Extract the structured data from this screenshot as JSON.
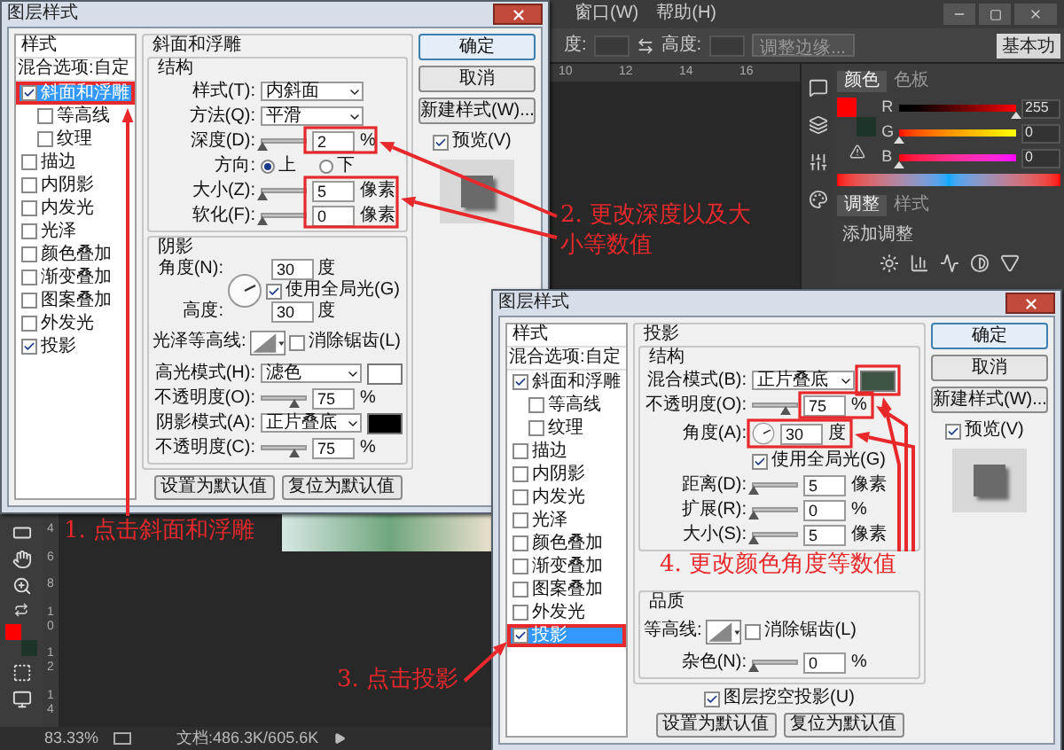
{
  "menu": [
    {
      "label": "窗口(W)"
    },
    {
      "label": "帮助(H)"
    }
  ],
  "options_bar": {
    "fields": [
      {
        "label": "度:"
      },
      {
        "label": "高度:"
      }
    ],
    "refine_button": "调整边缘...",
    "workspace_button": "基本功"
  },
  "top_ruler": [
    "10",
    "12",
    "14",
    "16"
  ],
  "left_ruler": [
    "4",
    "6",
    "8",
    "10",
    "12",
    "14"
  ],
  "color_panel": {
    "tabs": [
      {
        "label": "颜色",
        "selected": true
      },
      {
        "label": "色板",
        "selected": false
      }
    ],
    "foreground": {
      "color": "#ff0000"
    },
    "background": {
      "color": "#1d3528"
    },
    "channels": [
      {
        "name": "R",
        "level": 1,
        "value": "255"
      },
      {
        "name": "G",
        "level": 0,
        "value": "0"
      },
      {
        "name": "B",
        "level": 0,
        "value": "0"
      }
    ]
  },
  "adjustments_panel": {
    "tabs": [
      {
        "label": "调整",
        "selected": true
      },
      {
        "label": "样式",
        "selected": false
      }
    ],
    "title": "添加调整"
  },
  "status_bar": {
    "zoom": "83.33%",
    "document": "文档:486.3K/605.6K"
  },
  "dialogs": [
    {
      "title": "图层样式",
      "styles": {
        "header": "样式",
        "blend": "混合选项:自定",
        "items": [
          {
            "label": "斜面和浮雕",
            "checked": true,
            "selected": true,
            "highlighted": true,
            "children": [
              {
                "label": "等高线",
                "checked": false,
                "selected": false,
                "highlighted": false
              },
              {
                "label": "纹理",
                "checked": false,
                "selected": false,
                "highlighted": false
              }
            ]
          },
          {
            "label": "描边",
            "checked": false,
            "selected": false,
            "highlighted": false
          },
          {
            "label": "内阴影",
            "checked": false,
            "selected": false,
            "highlighted": false
          },
          {
            "label": "内发光",
            "checked": false,
            "selected": false,
            "highlighted": false
          },
          {
            "label": "光泽",
            "checked": false,
            "selected": false,
            "highlighted": false
          },
          {
            "label": "颜色叠加",
            "checked": false,
            "selected": false,
            "highlighted": false
          },
          {
            "label": "渐变叠加",
            "checked": false,
            "selected": false,
            "highlighted": false
          },
          {
            "label": "图案叠加",
            "checked": false,
            "selected": false,
            "highlighted": false
          },
          {
            "label": "外发光",
            "checked": false,
            "selected": false,
            "highlighted": false
          },
          {
            "label": "投影",
            "checked": true,
            "selected": false,
            "highlighted": false
          }
        ]
      },
      "section": {
        "title": "斜面和浮雕",
        "groups": [
          {
            "title": "结构",
            "rows": [
              {
                "kind": "select",
                "label": "样式(T):",
                "value": "内斜面"
              },
              {
                "kind": "select",
                "label": "方法(Q):",
                "value": "平滑"
              },
              {
                "kind": "slider",
                "label": "深度(D):",
                "level": 0.02,
                "value": "2",
                "unit": "%"
              },
              {
                "kind": "radio",
                "label": "方向:",
                "options": [
                  {
                    "label": "上",
                    "selected": true
                  },
                  {
                    "label": "下",
                    "selected": false
                  }
                ]
              },
              {
                "kind": "slider",
                "label": "大小(Z):",
                "level": 0.02,
                "value": "5",
                "unit": "像素"
              },
              {
                "kind": "slider",
                "label": "软化(F):",
                "level": 0,
                "value": "0",
                "unit": "像素"
              }
            ]
          },
          {
            "title": "阴影",
            "rows": [
              {
                "kind": "angle",
                "label": "角度(N):",
                "value": "30",
                "unit": "度",
                "global": {
                  "label": "使用全局光(G)",
                  "checked": true
                },
                "altitude": {
                  "label": "高度:",
                  "value": "30",
                  "unit": "度"
                }
              },
              {
                "kind": "contour",
                "label": "光泽等高线:",
                "antialias": {
                  "label": "消除锯齿(L)",
                  "checked": false
                }
              },
              {
                "kind": "select",
                "label": "高光模式(H):",
                "value": "滤色",
                "color": "#ffffff"
              },
              {
                "kind": "slider",
                "label": "不透明度(O):",
                "level": 0.75,
                "value": "75",
                "unit": "%"
              },
              {
                "kind": "select",
                "label": "阴影模式(A):",
                "value": "正片叠底",
                "color": "#000000"
              },
              {
                "kind": "slider",
                "label": "不透明度(C):",
                "level": 0.75,
                "value": "75",
                "unit": "%"
              }
            ]
          }
        ]
      },
      "footer": [
        "设置为默认值",
        "复位为默认值"
      ],
      "buttons": [
        {
          "label": "确定",
          "default": true
        },
        {
          "label": "取消",
          "default": false
        },
        {
          "label": "新建样式(W)...",
          "default": false
        }
      ],
      "preview": {
        "label": "预览(V)",
        "checked": true
      }
    },
    {
      "title": "图层样式",
      "styles": {
        "header": "样式",
        "blend": "混合选项:自定",
        "items": [
          {
            "label": "斜面和浮雕",
            "checked": true,
            "selected": false,
            "highlighted": false,
            "children": [
              {
                "label": "等高线",
                "checked": false,
                "selected": false,
                "highlighted": false
              },
              {
                "label": "纹理",
                "checked": false,
                "selected": false,
                "highlighted": false
              }
            ]
          },
          {
            "label": "描边",
            "checked": false,
            "selected": false,
            "highlighted": false
          },
          {
            "label": "内阴影",
            "checked": false,
            "selected": false,
            "highlighted": false
          },
          {
            "label": "内发光",
            "checked": false,
            "selected": false,
            "highlighted": false
          },
          {
            "label": "光泽",
            "checked": false,
            "selected": false,
            "highlighted": false
          },
          {
            "label": "颜色叠加",
            "checked": false,
            "selected": false,
            "highlighted": false
          },
          {
            "label": "渐变叠加",
            "checked": false,
            "selected": false,
            "highlighted": false
          },
          {
            "label": "图案叠加",
            "checked": false,
            "selected": false,
            "highlighted": false
          },
          {
            "label": "外发光",
            "checked": false,
            "selected": false,
            "highlighted": false
          },
          {
            "label": "投影",
            "checked": true,
            "selected": true,
            "highlighted": true
          }
        ]
      },
      "section": {
        "title": "投影",
        "groups": [
          {
            "title": "结构",
            "rows": [
              {
                "kind": "select",
                "label": "混合模式(B):",
                "value": "正片叠底",
                "color": "#3d5445"
              },
              {
                "kind": "slider",
                "label": "不透明度(O):",
                "level": 0.75,
                "value": "75",
                "unit": "%"
              },
              {
                "kind": "angle",
                "label": "角度(A):",
                "value": "30",
                "unit": "度",
                "global": {
                  "label": "使用全局光(G)",
                  "checked": true
                }
              },
              {
                "kind": "slider",
                "label": "距离(D):",
                "level": 0.02,
                "value": "5",
                "unit": "像素"
              },
              {
                "kind": "slider",
                "label": "扩展(R):",
                "level": 0,
                "value": "0",
                "unit": "%"
              },
              {
                "kind": "slider",
                "label": "大小(S):",
                "level": 0.02,
                "value": "5",
                "unit": "像素"
              }
            ]
          },
          {
            "title": "品质",
            "rows": [
              {
                "kind": "contour",
                "label": "等高线:",
                "antialias": {
                  "label": "消除锯齿(L)",
                  "checked": false
                }
              },
              {
                "kind": "slider",
                "label": "杂色(N):",
                "level": 0,
                "value": "0",
                "unit": "%"
              }
            ]
          }
        ]
      },
      "knockout": {
        "label": "图层挖空投影(U)",
        "checked": true
      },
      "footer": [
        "设置为默认值",
        "复位为默认值"
      ],
      "buttons": [
        {
          "label": "确定",
          "default": true
        },
        {
          "label": "取消",
          "default": false
        },
        {
          "label": "新建样式(W)...",
          "default": false
        }
      ],
      "preview": {
        "label": "预览(V)",
        "checked": true
      }
    }
  ],
  "annotations": [
    {
      "text": "1. 点击斜面和浮雕"
    },
    {
      "text": "2. 更改深度以及大小等数值"
    },
    {
      "text": "3. 点击投影"
    },
    {
      "text": "4. 更改颜色角度等数值"
    }
  ]
}
